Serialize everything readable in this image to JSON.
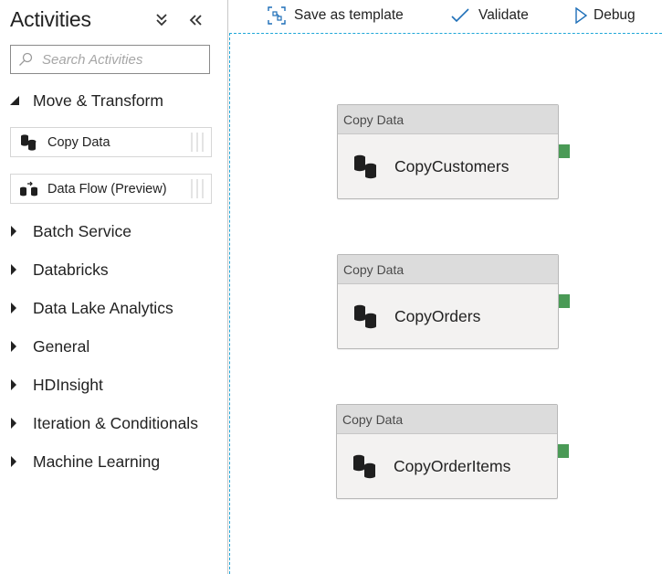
{
  "colors": {
    "accent": "#1fa7d8",
    "port_green": "#4a9a56",
    "node_header": "#dcdcdc",
    "node_body": "#f3f2f1"
  },
  "panel": {
    "title": "Activities",
    "collapse_all_icon": "double-chevron-down-icon",
    "hide_panel_icon": "double-chevron-left-icon"
  },
  "search": {
    "placeholder": "Search Activities",
    "value": "",
    "icon": "search-icon"
  },
  "categories": [
    {
      "label": "Move & Transform",
      "expanded": true
    },
    {
      "label": "Batch Service",
      "expanded": false
    },
    {
      "label": "Databricks",
      "expanded": false
    },
    {
      "label": "Data Lake Analytics",
      "expanded": false
    },
    {
      "label": "General",
      "expanded": false
    },
    {
      "label": "HDInsight",
      "expanded": false
    },
    {
      "label": "Iteration & Conditionals",
      "expanded": false
    },
    {
      "label": "Machine Learning",
      "expanded": false
    }
  ],
  "activities": [
    {
      "label": "Copy Data",
      "icon": "copy-data-icon"
    },
    {
      "label": "Data Flow (Preview)",
      "icon": "data-flow-icon"
    }
  ],
  "toolbar": {
    "save_template": "Save as template",
    "validate": "Validate",
    "debug": "Debug"
  },
  "nodes": [
    {
      "type": "Copy Data",
      "name": "CopyCustomers"
    },
    {
      "type": "Copy Data",
      "name": "CopyOrders"
    },
    {
      "type": "Copy Data",
      "name": "CopyOrderItems"
    }
  ]
}
